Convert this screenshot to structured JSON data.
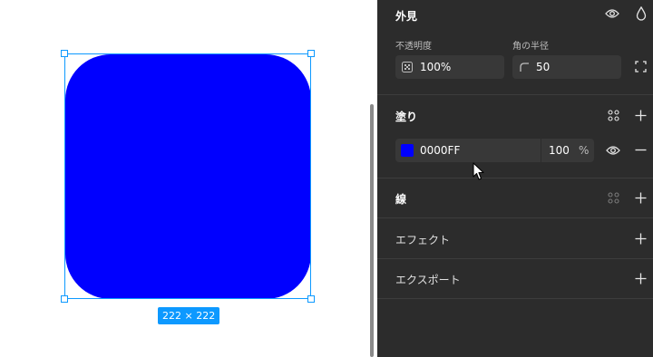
{
  "canvas": {
    "shape_color": "#0000FF",
    "size_label": "222 × 222"
  },
  "panel": {
    "appearance": {
      "title": "外見",
      "opacity_label": "不透明度",
      "opacity_value": "100%",
      "radius_label": "角の半径",
      "radius_value": "50"
    },
    "fill": {
      "title": "塗り",
      "hex": "0000FF",
      "opacity": "100",
      "percent": "%"
    },
    "stroke": {
      "title": "線"
    },
    "effects": {
      "title": "エフェクト"
    },
    "export": {
      "title": "エクスポート"
    }
  },
  "icons": [
    "eye-icon",
    "drop-icon",
    "opacity-icon",
    "corner-radius-icon",
    "independent-corners-icon",
    "styles-grid-icon",
    "plus-icon",
    "minus-icon",
    "cursor-icon"
  ]
}
